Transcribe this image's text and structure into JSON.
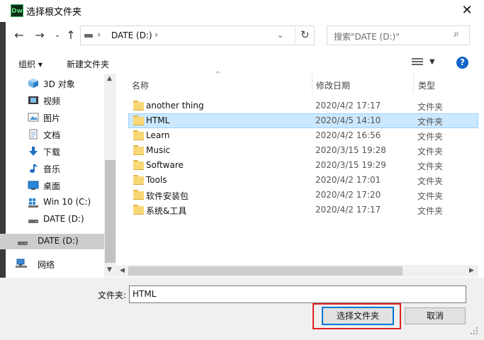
{
  "titlebar": {
    "app_icon": "Dw",
    "title": "选择根文件夹"
  },
  "nav": {
    "path": "DATE (D:)",
    "search_placeholder": "搜索\"DATE (D:)\""
  },
  "toolbar": {
    "organize": "组织 ▾",
    "new_folder": "新建文件夹"
  },
  "sidebar": {
    "items": [
      {
        "label": "3D 对象",
        "icon": "cube-3d-icon"
      },
      {
        "label": "视频",
        "icon": "video-icon"
      },
      {
        "label": "图片",
        "icon": "pictures-icon"
      },
      {
        "label": "文档",
        "icon": "documents-icon"
      },
      {
        "label": "下载",
        "icon": "download-icon"
      },
      {
        "label": "音乐",
        "icon": "music-icon"
      },
      {
        "label": "桌面",
        "icon": "desktop-icon"
      },
      {
        "label": "Win 10 (C:)",
        "icon": "windows-drive-icon"
      },
      {
        "label": "DATE (D:)",
        "icon": "drive-icon"
      },
      {
        "label": "DATE (D:)",
        "icon": "drive-icon",
        "selected": true
      },
      {
        "label": "网络",
        "icon": "network-icon"
      }
    ]
  },
  "columns": {
    "name": "名称",
    "date": "修改日期",
    "type": "类型"
  },
  "files": [
    {
      "name": "another thing",
      "date": "2020/4/2 17:17",
      "type": "文件夹"
    },
    {
      "name": "HTML",
      "date": "2020/4/5 14:10",
      "type": "文件夹",
      "selected": true
    },
    {
      "name": "Learn",
      "date": "2020/4/2 16:56",
      "type": "文件夹"
    },
    {
      "name": "Music",
      "date": "2020/3/15 19:28",
      "type": "文件夹"
    },
    {
      "name": "Software",
      "date": "2020/3/15 19:29",
      "type": "文件夹"
    },
    {
      "name": "Tools",
      "date": "2020/4/2 17:01",
      "type": "文件夹"
    },
    {
      "name": "软件安装包",
      "date": "2020/4/2 17:20",
      "type": "文件夹"
    },
    {
      "name": "系统&工具",
      "date": "2020/4/2 17:17",
      "type": "文件夹"
    }
  ],
  "footer": {
    "folder_label": "文件夹:",
    "folder_value": "HTML",
    "select_button": "选择文件夹",
    "cancel_button": "取消"
  },
  "colors": {
    "selection": "#cce8ff",
    "highlight": "#e02020",
    "accent": "#0078d7"
  }
}
